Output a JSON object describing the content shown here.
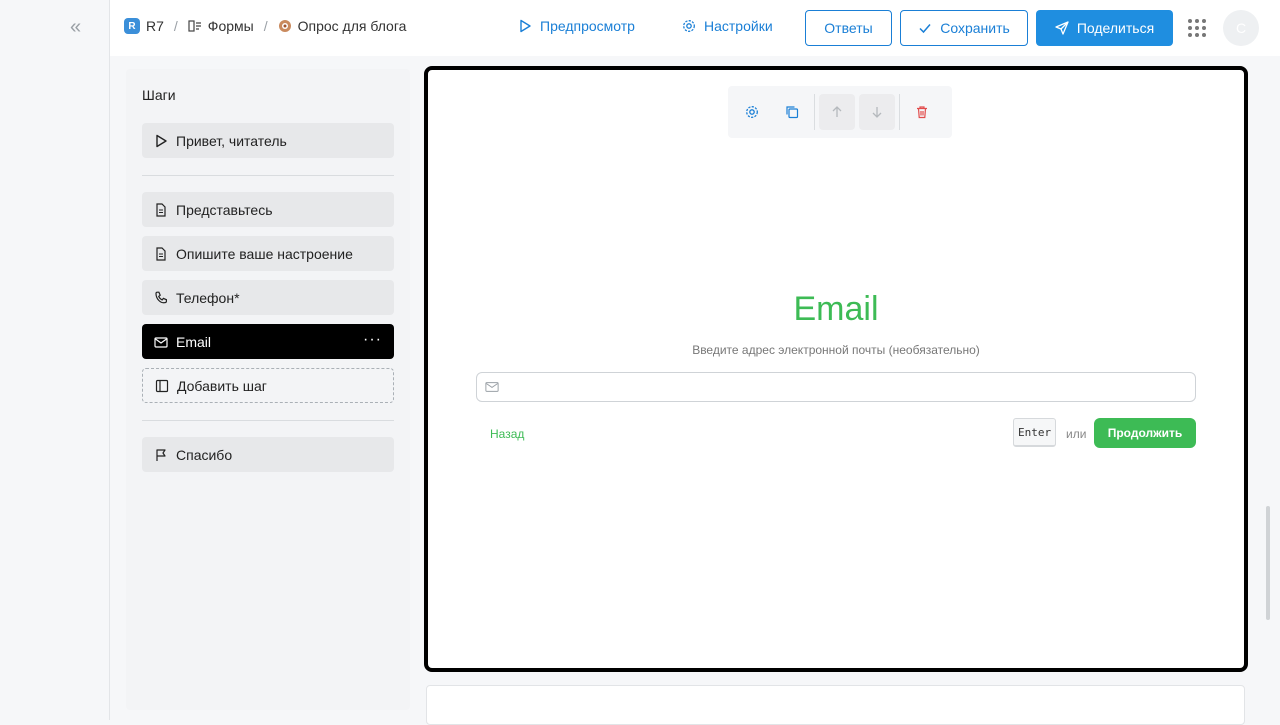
{
  "breadcrumb": {
    "workspace_badge": "R",
    "workspace": "R7",
    "section": "Формы",
    "form": "Опрос для блога"
  },
  "topbar": {
    "preview_label": "Предпросмотр",
    "settings_label": "Настройки",
    "responses_label": "Ответы",
    "save_label": "Сохранить",
    "share_label": "Поделиться",
    "avatar_initial": "С"
  },
  "collapse_glyph": "«",
  "steps": {
    "title": "Шаги",
    "welcome": {
      "label": "Привет, читатель",
      "icon": "play-icon"
    },
    "items": [
      {
        "label": "Представьтесь",
        "icon": "document-icon"
      },
      {
        "label": "Опишите ваше настроение",
        "icon": "document-icon"
      },
      {
        "label": "Телефон*",
        "icon": "phone-icon"
      },
      {
        "label": "Email",
        "icon": "mail-icon",
        "active": true
      }
    ],
    "add_label": "Добавить шаг",
    "ending": {
      "label": "Спасибо",
      "icon": "flag-icon"
    }
  },
  "question": {
    "title": "Email",
    "subtitle": "Введите адрес электронной почты (необязательно)",
    "input_value": "",
    "back_label": "Назад",
    "enter_key": "Enter",
    "or_label": "или",
    "continue_label": "Продолжить"
  },
  "colors": {
    "accent": "#1f8ee0",
    "success": "#3dbb55",
    "danger": "#e24c4c",
    "active_step_bg": "#000000"
  }
}
